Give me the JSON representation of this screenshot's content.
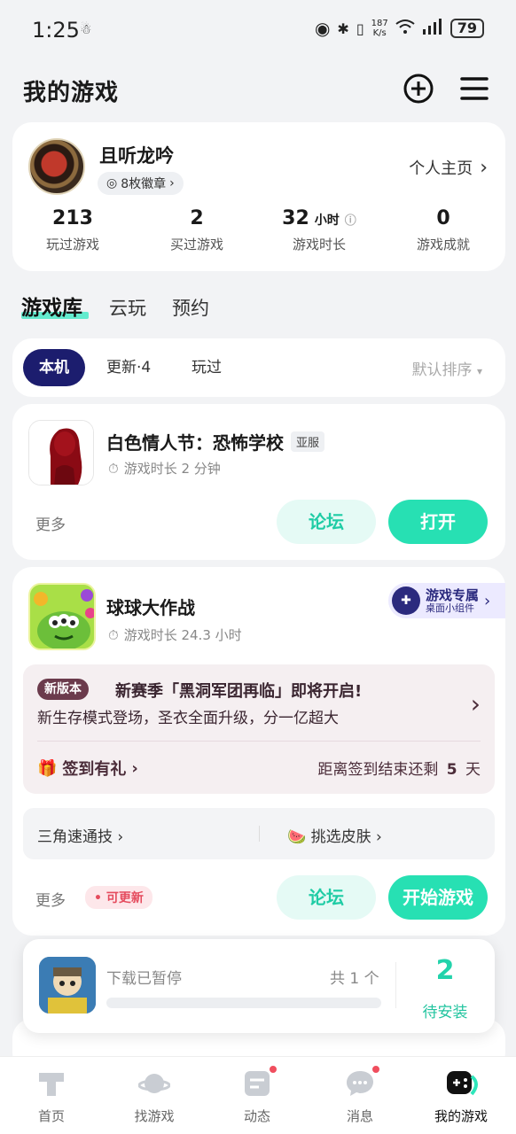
{
  "status_bar": {
    "time": "1:25",
    "net_speed_value": "187",
    "net_speed_unit": "K/s",
    "battery": "79"
  },
  "header": {
    "title": "我的游戏"
  },
  "profile": {
    "username": "且听龙吟",
    "badges": "8枚徽章",
    "homepage_link": "个人主页",
    "stats": [
      {
        "value": "213",
        "unit": "",
        "label": "玩过游戏"
      },
      {
        "value": "2",
        "unit": "",
        "label": "买过游戏"
      },
      {
        "value": "32",
        "unit": "小时",
        "label": "游戏时长"
      },
      {
        "value": "0",
        "unit": "",
        "label": "游戏成就"
      }
    ]
  },
  "library_tabs": [
    "游戏库",
    "云玩",
    "预约"
  ],
  "filters": {
    "chips": [
      "本机",
      "更新·4",
      "玩过"
    ],
    "sort": "默认排序"
  },
  "game1": {
    "title": "白色情人节：恐怖学校",
    "region_tag": "亚服",
    "playtime": "游戏时长 2 分钟",
    "more": "更多",
    "forum_btn": "论坛",
    "open_btn": "打开"
  },
  "game2": {
    "title": "球球大作战",
    "playtime": "游戏时长 24.3 小时",
    "widget_title": "游戏专属",
    "widget_sub": "桌面小组件",
    "news_tag": "新版本",
    "news_title": "新赛季「黑洞军团再临」即将开启!",
    "news_sub": "新生存模式登场，圣衣全面升级，分一亿超大",
    "signin": "签到有礼",
    "signin_remain_prefix": "距离签到结束还剩",
    "signin_remain_days": "5",
    "signin_remain_suffix": "天",
    "quick_links": [
      "三角速通技",
      "挑选皮肤"
    ],
    "more": "更多",
    "update_tag": "可更新",
    "forum_btn": "论坛",
    "start_btn": "开始游戏"
  },
  "download": {
    "status": "下载已暂停",
    "count": "共 1 个",
    "pending_num": "2",
    "pending_label": "待安装"
  },
  "bottom_nav": [
    {
      "label": "首页"
    },
    {
      "label": "找游戏"
    },
    {
      "label": "动态"
    },
    {
      "label": "消息"
    },
    {
      "label": "我的游戏"
    }
  ]
}
